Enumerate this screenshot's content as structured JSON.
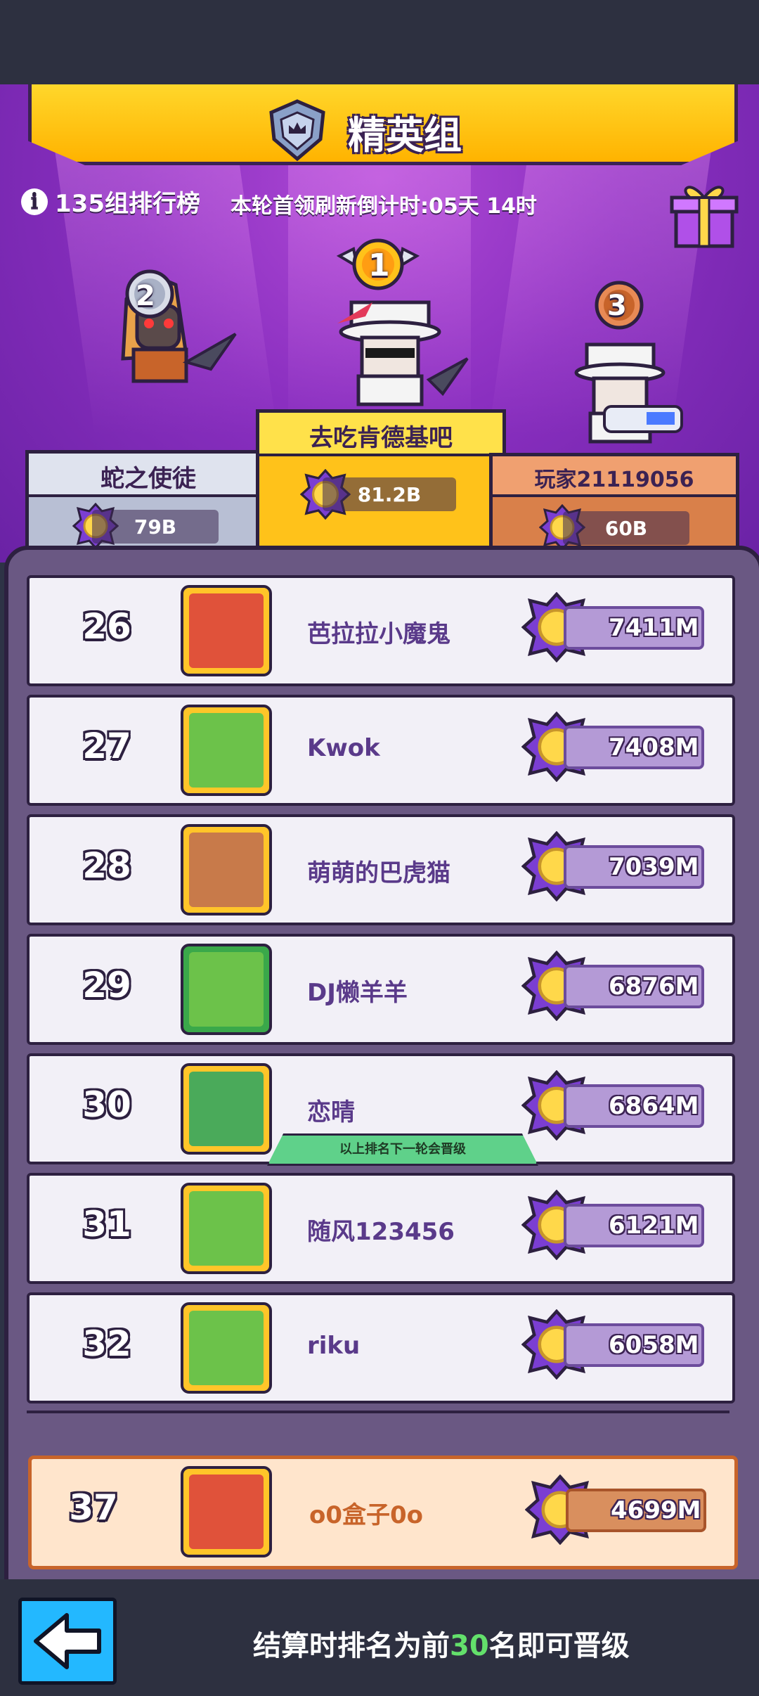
{
  "header": {
    "title": "精英组",
    "info_text": "135组排行榜",
    "timer_text": "本轮首领刷新倒计时:05天 14时"
  },
  "podium": [
    {
      "rank": "2",
      "name": "蛇之使徒",
      "score": "79B"
    },
    {
      "rank": "1",
      "name": "去吃肯德基吧",
      "score": "81.2B"
    },
    {
      "rank": "3",
      "name": "玩家21119056",
      "score": "60B"
    }
  ],
  "leaderboard": {
    "rows": [
      {
        "rank": "26",
        "name": "芭拉拉小魔鬼",
        "score": "7411M"
      },
      {
        "rank": "27",
        "name": "Kwok",
        "score": "7408M"
      },
      {
        "rank": "28",
        "name": "萌萌的巴虎猫",
        "score": "7039M"
      },
      {
        "rank": "29",
        "name": "DJ懒羊羊",
        "score": "6876M"
      },
      {
        "rank": "30",
        "name": "恋晴",
        "score": "6864M"
      },
      {
        "rank": "31",
        "name": "随风123456",
        "score": "6121M"
      },
      {
        "rank": "32",
        "name": "riku",
        "score": "6058M"
      }
    ],
    "promotion_line_text": "以上排名下一轮会晋级",
    "self": {
      "rank": "37",
      "name": "o0盒子0o",
      "score": "4699M"
    }
  },
  "footer": {
    "text_before": "结算时排名为前",
    "text_highlight": "30",
    "text_after": "名即可晋级"
  },
  "colors": {
    "panel_purple": "#6a5883",
    "banner_gold": "#ffc21a",
    "highlight_green": "#63e06b",
    "back_button_blue": "#23b8ff"
  }
}
